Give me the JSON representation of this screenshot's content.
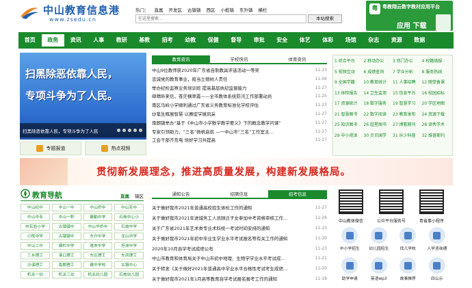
{
  "header": {
    "site_name": "中山教育信息港",
    "site_url": "www.zsedu.cn",
    "hot_label": "热门：",
    "hot_links": [
      "直属",
      "开发区",
      "古镇镇",
      "西区",
      "小榄镇",
      "东升镇",
      "横栏"
    ],
    "search_placeholder": "在这里搜索...",
    "search_button": "本站搜索",
    "app_title": "粤教翔云数字教材应用平台",
    "app_subtitle": "应用 下载"
  },
  "nav": [
    "首页",
    "政务",
    "资讯",
    "人事",
    "教研",
    "基教",
    "招考",
    "幼教",
    "保健",
    "督导",
    "审批",
    "安全",
    "体艺",
    "体彩",
    "场馆",
    "杂志",
    "资源",
    "数据"
  ],
  "nav_active": "政务",
  "hero": {
    "line1": "扫黑除恶依靠人民，",
    "line2": "专项斗争为了人民。",
    "caption": "扫黑除恶依靠人民，专项斗争为了人民",
    "btn_topic": "专题报道",
    "btn_video": "热点视频"
  },
  "news": {
    "tabs": [
      "教育资讯",
      "学校快讯",
      "体育资讯"
    ],
    "items": [
      {
        "title": "中山9位教师获2020年广东省自制教具评选活动一等奖",
        "date": "11-23"
      },
      {
        "title": "忠诚党的教育事业，担当立德树人责任",
        "date": "11-06"
      },
      {
        "title": "举办纪检监察业务培训班 提高基层执纪监督能力",
        "date": "11-27"
      },
      {
        "title": "邮晴昕来信，苍茫横翠霞——全市教体系统防汛工作部署动员",
        "date": "11-25"
      },
      {
        "title": "南区马岭小学顺利通过广东省义务教育标准化学校评估",
        "date": "11-23"
      },
      {
        "title": "炒笔生辉展智慧 以赛促学展风采",
        "date": "11-27"
      },
      {
        "title": "南朗镇举办“基于《中山市小学数学教学要义》下的概念教学问课”",
        "date": "11-27"
      },
      {
        "title": "专家引领助力，“三名”扬帆启航 —一中山市“三名”工作室主…",
        "date": "11-27"
      },
      {
        "title": "工会干部齐充电 培好学习共提高",
        "date": "11-27"
      }
    ]
  },
  "grid": [
    "综合平台",
    "移动办公",
    "热门办公",
    "权籍填报",
    "视频互动",
    "成绩查询",
    "学业分析",
    "服务热线",
    "全国学籍",
    "教育统计",
    "人事招聘",
    "随堂备课",
    "体检报告",
    "卫生监测",
    "信息平台",
    "校园招标",
    "资源统计",
    "数字服务",
    "智慧学习",
    "学区地图",
    "智慧图书",
    "数字阅读",
    "教育发布",
    "资源下载",
    "知识图书",
    "超星图书",
    "博看期刊",
    "读秀学术",
    "中小视读",
    "贝贝国学",
    "乐少科普",
    "维普期刊"
  ],
  "slogan": "贯彻新发展理念，推进高质量发展，构建新发展格局。",
  "edu_nav": {
    "title": "教育导航",
    "tabs": [
      "直属",
      "镇区"
    ],
    "schools": [
      "中山纪中",
      "中山一中",
      "中山侨中",
      "中山实中",
      "中山中专",
      "中山一职",
      "建勤中学",
      "石岐中心小",
      "市实验小学",
      "古镇镇中",
      "中山华侨中",
      "石岐中学",
      "小榄中学",
      "古镇镇中",
      "东升中学",
      "龙山中学",
      "中山二中",
      "横栏中学",
      "逸夫中学",
      "坦洲中学",
      "三乡理工",
      "港口理工",
      "东区理工",
      "东凤理工",
      "沙溪理工",
      "南朗理工",
      "建中学校",
      "古镇中心",
      "机关一幼",
      "机关三幼",
      "机关幼儿园",
      "石岐幼儿园"
    ]
  },
  "notice": {
    "tabs": [
      "通知公告",
      "招聘信息",
      "招考信息"
    ],
    "items": [
      {
        "title": "关于做好我市2021年普通高校招生体检工作的通知",
        "date": "11-27"
      },
      {
        "title": "关于做好我市2021年进城务工人员随迁子女参加中考资格审核工作…",
        "date": "11-26"
      },
      {
        "title": "关于广东省2021年艺术类专业术科统一考试时间安排的通知",
        "date": "11-23"
      },
      {
        "title": "关于做好我市2021年初中毕业生学业水平考试报名等有关工作的通知",
        "date": "11-30"
      },
      {
        "title": "2020年10月自学考试成绩公布",
        "date": "11-23"
      },
      {
        "title": "中山市教育和体育局关于中山市初中地理、生物学学业水平考试成…",
        "date": "11-21"
      },
      {
        "title": "关于转发《关于做好2021年普通高中学业水平合格性考试考生成绩…",
        "date": "11-20"
      },
      {
        "title": "关于做好我市2021年1月高等教育自学考试报名报考工作的通知",
        "date": "11-18"
      }
    ]
  },
  "qr": [
    "中山教体微信",
    "公众平台服务号",
    "粤省事小程序"
  ],
  "services": [
    "中小学招生",
    "幼儿园招生",
    "找几学校",
    "入学咨询通",
    "助学申请",
    "英语wp3",
    "故事推荐",
    "四公示"
  ]
}
